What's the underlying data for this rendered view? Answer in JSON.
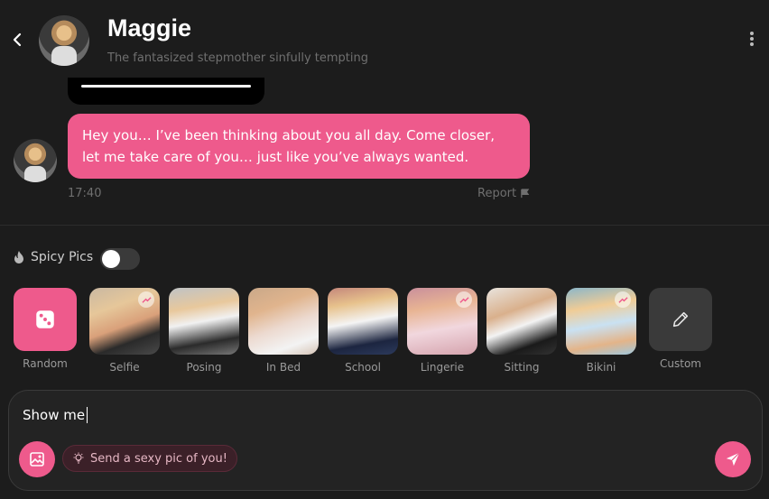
{
  "header": {
    "name": "Maggie",
    "subtitle": "The fantasized stepmother sinfully tempting"
  },
  "chat": {
    "message": "Hey you… I’ve been thinking about you all day. Come closer, let me take care of you… just like you’ve always wanted.",
    "time": "17:40",
    "report_label": "Report"
  },
  "spicy": {
    "label": "Spicy Pics",
    "enabled": false
  },
  "categories": [
    {
      "label": "Random",
      "icon": "dice-icon"
    },
    {
      "label": "Selfie",
      "trending": true
    },
    {
      "label": "Posing",
      "trending": false
    },
    {
      "label": "In Bed",
      "trending": false
    },
    {
      "label": "School",
      "trending": false
    },
    {
      "label": "Lingerie",
      "trending": true
    },
    {
      "label": "Sitting",
      "trending": false
    },
    {
      "label": "Bikini",
      "trending": true
    },
    {
      "label": "Custom",
      "icon": "pencil-icon"
    }
  ],
  "composer": {
    "value": "Show me",
    "suggestion": "Send a sexy pic of you!"
  },
  "colors": {
    "accent": "#ee5a8c",
    "background": "#1c1c1c"
  }
}
